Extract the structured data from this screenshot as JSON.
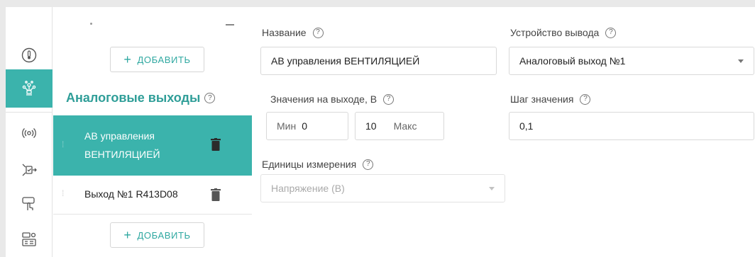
{
  "sidebar_rail": {
    "icons": [
      "thermometer-icon",
      "sensor-network-icon",
      "radio-signal-icon",
      "output-icon",
      "touch-icon",
      "settings-panel-icon"
    ],
    "active_index": 1,
    "accent": "#3bb3ac"
  },
  "channel_list": {
    "add_label": "ДОБАВИТЬ",
    "add_plus": "+",
    "section_title": "Аналоговые выходы",
    "items": [
      {
        "label": "АВ управления ВЕНТИЛЯЦИЕЙ",
        "active": true
      },
      {
        "label": "Выход №1 R413D08",
        "active": false
      }
    ]
  },
  "form": {
    "name_label": "Название",
    "name_value": "АВ управления ВЕНТИЛЯЦИЕЙ",
    "device_label": "Устройство вывода",
    "device_value": "Аналоговый выход №1",
    "output_label": "Значения на выходе, В",
    "min_label": "Мин",
    "min_value": "0",
    "max_value": "10",
    "max_label": "Макс",
    "step_label": "Шаг значения",
    "step_value": "0,1",
    "units_label": "Единицы измерения",
    "units_value": "Напряжение (В)"
  }
}
